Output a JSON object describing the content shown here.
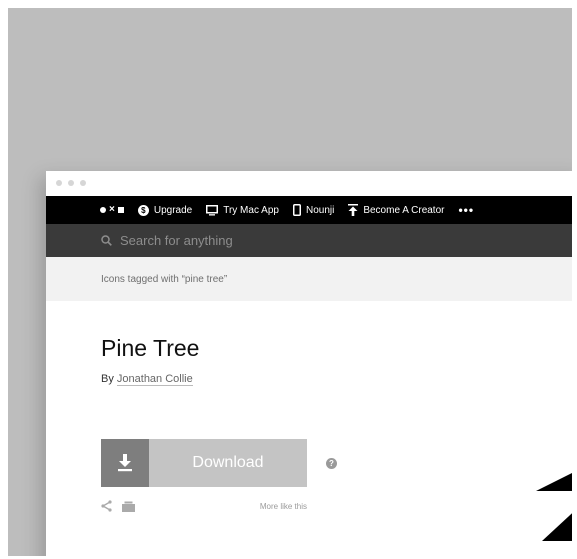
{
  "window": {
    "dots_color": "#d6d6d6"
  },
  "nav": {
    "logo_x": "×",
    "items": [
      {
        "label": "Upgrade",
        "icon": "dollar-coin-icon"
      },
      {
        "label": "Try Mac App",
        "icon": "monitor-icon"
      },
      {
        "label": "Nounji",
        "icon": "phone-icon"
      },
      {
        "label": "Become A Creator",
        "icon": "upload-icon"
      }
    ],
    "more": "•••"
  },
  "search": {
    "placeholder": "Search for anything"
  },
  "tagbar": {
    "text": "Icons tagged with “pine tree”"
  },
  "icon_page": {
    "title": "Pine Tree",
    "by_prefix": "By ",
    "author": "Jonathan Collie",
    "download_label": "Download",
    "help_glyph": "?",
    "more_like_this": "More like this"
  },
  "colors": {
    "backdrop": "#bdbdbd",
    "nav_bg": "#000000",
    "search_bg": "#3a3a3a",
    "tag_bg": "#f2f2f2",
    "download_bg": "#c4c4c4",
    "download_icon_bg": "#7e7e7e"
  }
}
